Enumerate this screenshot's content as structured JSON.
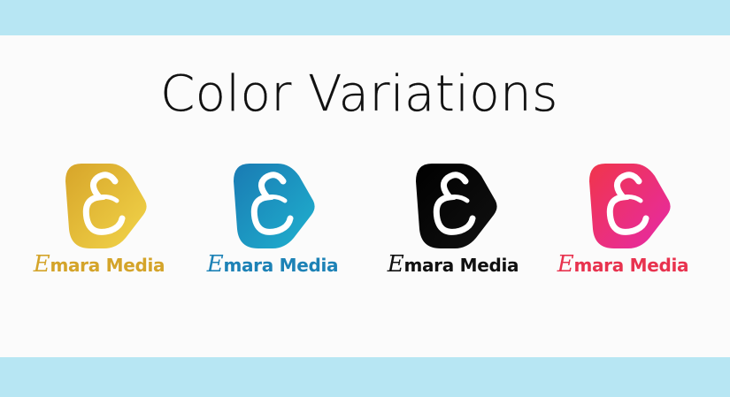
{
  "title": "Color Variations",
  "logos": [
    {
      "initial": "E",
      "name": "mara Media",
      "grad_from": "#d7a52a",
      "grad_to": "#f2d54a",
      "text_color": "#d4a42a"
    },
    {
      "initial": "E",
      "name": "mara Media",
      "grad_from": "#1a7bb3",
      "grad_to": "#1fb1cf",
      "text_color": "#1d82b6"
    },
    {
      "initial": "E",
      "name": "mara Media",
      "grad_from": "#000000",
      "grad_to": "#111111",
      "text_color": "#111111"
    },
    {
      "initial": "E",
      "name": "mara Media",
      "grad_from": "#f0354b",
      "grad_to": "#e62aa8",
      "text_color": "#e8334f"
    }
  ],
  "colors": {
    "band": "#b7e6f3",
    "background": "#fbfbfb"
  }
}
